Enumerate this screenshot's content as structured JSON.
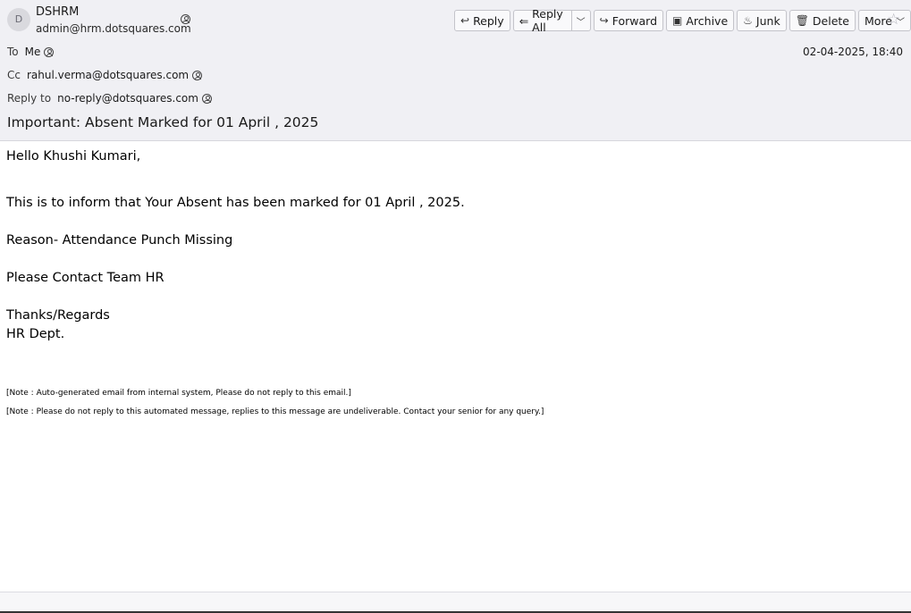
{
  "sender": {
    "avatar_initial": "D",
    "name": "DSHRM",
    "email": "admin@hrm.dotsquares.com"
  },
  "toolbar": {
    "reply": "Reply",
    "reply_all": "Reply All",
    "forward": "Forward",
    "archive": "Archive",
    "junk": "Junk",
    "delete": "Delete",
    "more": "More"
  },
  "headers": {
    "to_label": "To",
    "to_value": "Me",
    "cc_label": "Cc",
    "cc_value": "rahul.verma@dotsquares.com",
    "reply_to_label": "Reply to",
    "reply_to_value": "no-reply@dotsquares.com",
    "date": "02-04-2025, 18:40"
  },
  "subject": "Important: Absent Marked for 01 April , 2025",
  "body": {
    "greeting": "Hello Khushi Kumari,",
    "line1": "This is to inform that Your Absent has been marked for 01 April , 2025.",
    "reason": "Reason- Attendance Punch Missing",
    "contact": "Please Contact Team HR",
    "thanks": "Thanks/Regards",
    "dept": "HR Dept.",
    "note1": "[Note : Auto-generated email from internal system, Please do not reply to this email.]",
    "note2": "[Note : Please do not reply to this automated message, replies to this message are undeliverable. Contact your senior for any query.]"
  }
}
